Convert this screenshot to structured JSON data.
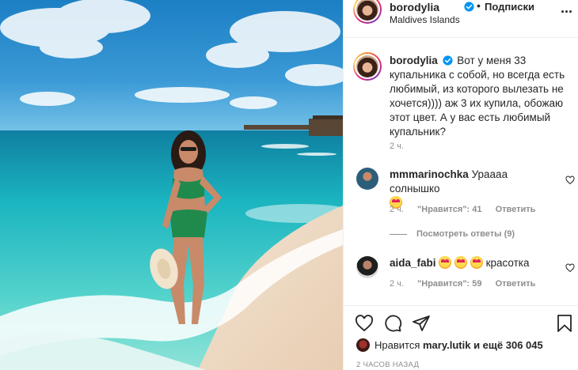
{
  "header": {
    "username": "borodylia",
    "dot": "•",
    "follow_label": "Подписки",
    "location": "Maldives Islands",
    "more_label": "···"
  },
  "caption": {
    "username": "borodylia",
    "text": "Вот у меня 33 купальника с собой, но всегда есть любимый, из которого вылезать не хочется)))) аж 3 их купила, обожаю этот цвет. А у вас есть любимый купальник?",
    "time": "2 ч."
  },
  "comments": [
    {
      "username": "mmmarinochka",
      "text": "Урaааа солнышко",
      "time": "2 ч.",
      "likes_label": "\"Нравится\": 41",
      "reply_label": "Ответить"
    },
    {
      "username": "aida_fabi",
      "text": "красотка",
      "time": "2 ч.",
      "likes_label": "\"Нравится\": 59",
      "reply_label": "Ответить"
    }
  ],
  "view_replies_label": "Посмотреть ответы (9)",
  "likes": {
    "prefix": "Нравится",
    "user": "mary.lutik",
    "suffix": "и ещё",
    "count": "306 045"
  },
  "time_ago": "2 ЧАСОВ НАЗАД",
  "icons": {
    "verified": "verified-badge-icon",
    "heart": "heart-icon",
    "comment": "comment-icon",
    "share": "share-icon",
    "save": "bookmark-icon"
  },
  "colors": {
    "accent": "#0095f6",
    "muted": "#8e8e8e",
    "text": "#262626"
  }
}
